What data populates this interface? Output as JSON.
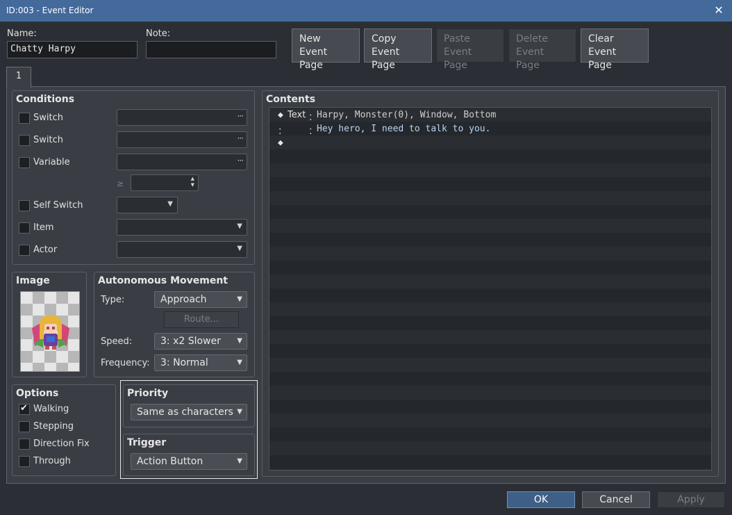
{
  "window": {
    "title": "ID:003 - Event Editor"
  },
  "header": {
    "name_label": "Name:",
    "name_value": "Chatty Harpy",
    "note_label": "Note:",
    "note_value": "",
    "buttons": {
      "new": [
        "New",
        "Event Page"
      ],
      "copy": [
        "Copy",
        "Event Page"
      ],
      "paste": [
        "Paste",
        "Event Page"
      ],
      "delete": [
        "Delete",
        "Event Page"
      ],
      "clear": [
        "Clear",
        "Event Page"
      ]
    }
  },
  "tabs": [
    {
      "label": "1"
    }
  ],
  "conditions": {
    "title": "Conditions",
    "switch1": "Switch",
    "switch2": "Switch",
    "variable": "Variable",
    "ge_symbol": "≥",
    "self_switch": "Self Switch",
    "item": "Item",
    "actor": "Actor"
  },
  "image": {
    "title": "Image"
  },
  "movement": {
    "title": "Autonomous Movement",
    "type_label": "Type:",
    "type_value": "Approach",
    "route_label": "Route...",
    "speed_label": "Speed:",
    "speed_value": "3: x2 Slower",
    "frequency_label": "Frequency:",
    "frequency_value": "3: Normal"
  },
  "options": {
    "title": "Options",
    "walking": "Walking",
    "stepping": "Stepping",
    "direction_fix": "Direction Fix",
    "through": "Through",
    "walking_checked": true
  },
  "priority": {
    "title": "Priority",
    "value": "Same as characters"
  },
  "trigger": {
    "title": "Trigger",
    "value": "Action Button"
  },
  "contents": {
    "title": "Contents",
    "lines": [
      {
        "marker": "◆",
        "cmd": "Text",
        "sep": "：",
        "text": "Harpy, Monster(0), Window, Bottom"
      },
      {
        "marker": "：",
        "cmd": "    ",
        "sep": "：",
        "text": "Hey hero, I need to talk to you."
      },
      {
        "marker": "◆",
        "cmd": "",
        "sep": "",
        "text": ""
      }
    ]
  },
  "footer": {
    "ok": "OK",
    "cancel": "Cancel",
    "apply": "Apply"
  },
  "colors": {
    "titlebar": "#436a9b",
    "ok_button": "#3e5f86",
    "text_blue": "#b8d4f5"
  }
}
